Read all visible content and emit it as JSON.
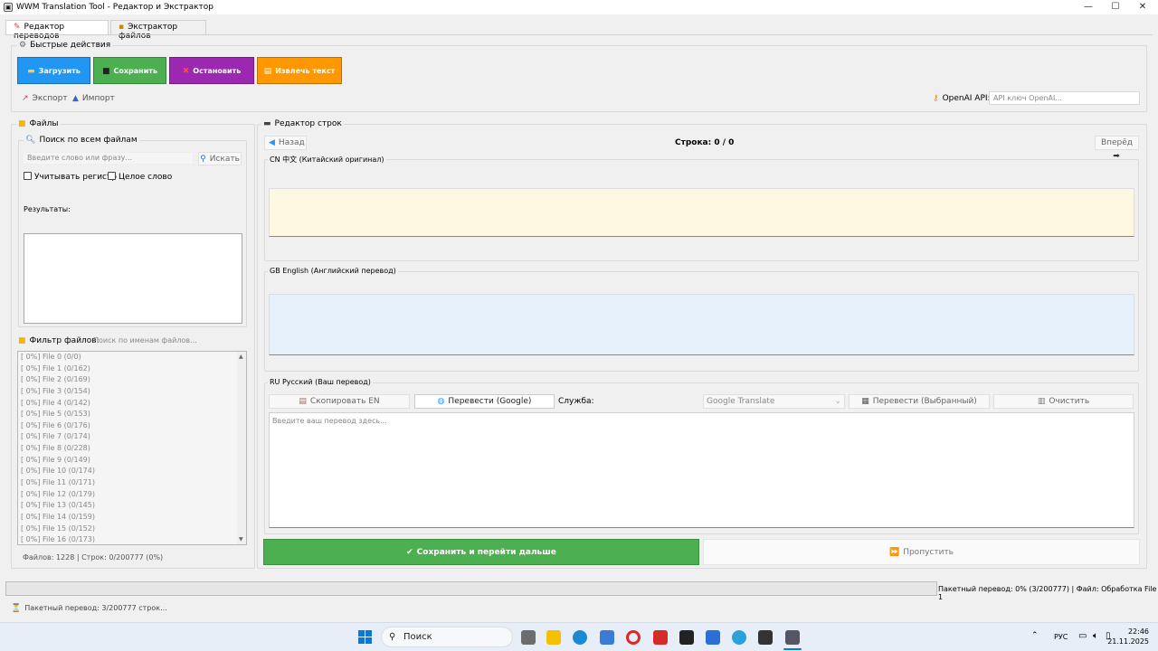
{
  "window": {
    "title": "WWM Translation Tool - Редактор и Экстрактор",
    "controls": {
      "minimize": "—",
      "maximize": "☐",
      "close": "✕"
    }
  },
  "tabs": [
    {
      "label": "Редактор переводов"
    },
    {
      "label": "Экстрактор файлов"
    }
  ],
  "quick_actions": {
    "title": "Быстрые действия",
    "buttons": [
      {
        "label": "Загрузить",
        "color": "#2196f3"
      },
      {
        "label": "Сохранить",
        "color": "#4caf50"
      },
      {
        "label": "Остановить",
        "color": "#9c27b0"
      },
      {
        "label": "Извлечь текст",
        "color": "#ff9800"
      }
    ],
    "export_label": "Экспорт",
    "import_label": "Импорт",
    "api_label": "OpenAI API:",
    "api_placeholder": "API ключ OpenAI..."
  },
  "files_panel": {
    "title": "Файлы",
    "search_title": "Поиск по всем файлам",
    "search_placeholder": "Введите слово или фразу...",
    "search_button": "Искать",
    "case_label": "Учитывать регистр",
    "whole_word_label": "Целое слово",
    "results_label": "Результаты:",
    "filter_label": "Фильтр файлов:",
    "filter_placeholder": "Поиск по именам файлов...",
    "files": [
      "[  0%] File 0 (0/0)",
      "[  0%] File 1 (0/162)",
      "[  0%] File 2 (0/169)",
      "[  0%] File 3 (0/154)",
      "[  0%] File 4 (0/142)",
      "[  0%] File 5 (0/153)",
      "[  0%] File 6 (0/176)",
      "[  0%] File 7 (0/174)",
      "[  0%] File 8 (0/228)",
      "[  0%] File 9 (0/149)",
      "[  0%] File 10 (0/174)",
      "[  0%] File 11 (0/171)",
      "[  0%] File 12 (0/179)",
      "[  0%] File 13 (0/145)",
      "[  0%] File 14 (0/159)",
      "[  0%] File 15 (0/152)",
      "[  0%] File 16 (0/173)"
    ],
    "stats": "Файлов: 1228 | Строк: 0/200777 (0%)"
  },
  "editor": {
    "title": "Редактор строк",
    "back_label": "Назад",
    "forward_label": "Вперёд",
    "row_counter": "Строка: 0 / 0",
    "cn_label": "CN 中文 (Китайский оригинал)",
    "en_label": "GB English (Английский перевод)",
    "ru_label": "RU Русский (Ваш перевод)",
    "copy_en": "Скопировать EN",
    "translate_google": "Перевести (Google)",
    "service_label": "Служба:",
    "service_value": "Google Translate",
    "translate_selected": "Перевести (Выбранный)",
    "clear": "Очистить",
    "ru_placeholder": "Введите ваш перевод здесь...",
    "save_next": "Сохранить и перейти дальше",
    "skip": "Пропустить"
  },
  "progress": {
    "value": 0,
    "text": "Пакетный перевод: 0% (3/200777) | Файл: Обработка File 1"
  },
  "status": {
    "text": "Пакетный перевод: 3/200777 строк..."
  },
  "taskbar": {
    "search_placeholder": "Поиск",
    "lang": "РУС",
    "time": "22:46",
    "date": "21.11.2025"
  }
}
